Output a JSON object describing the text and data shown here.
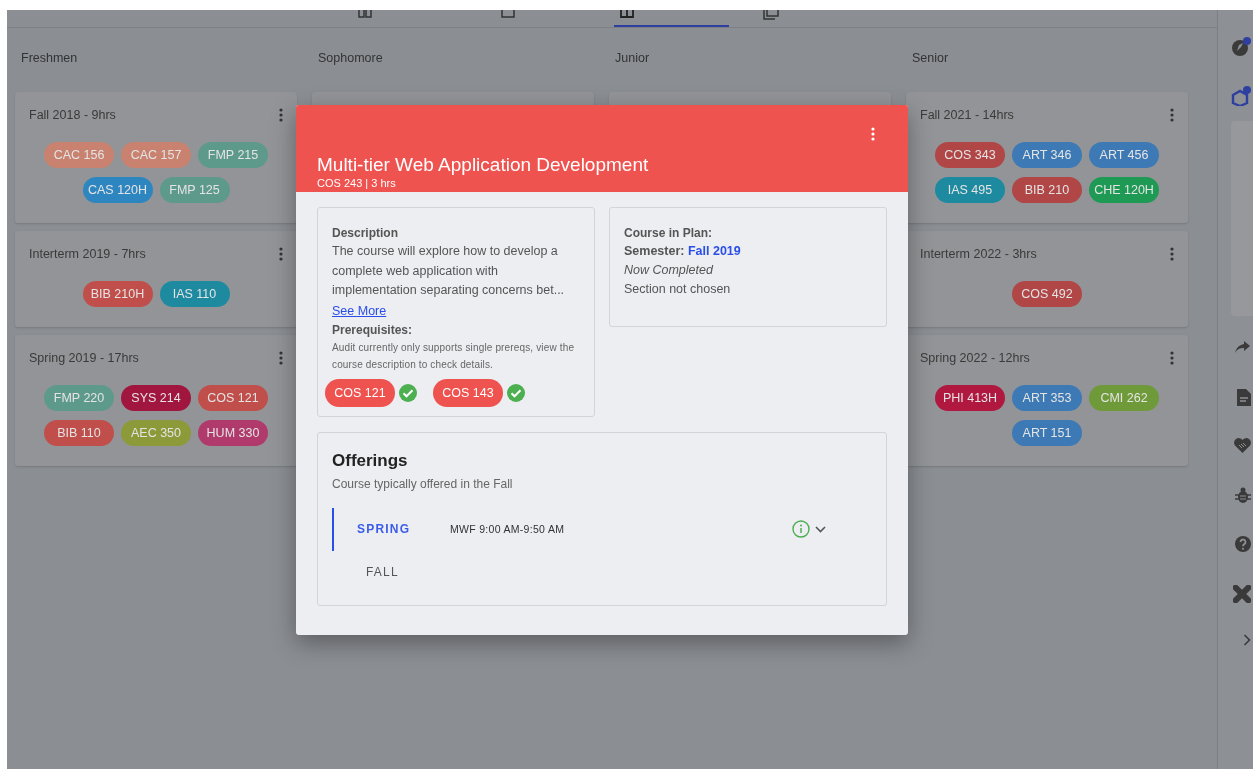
{
  "tabs": [
    {
      "kind": "grid",
      "selected": false
    },
    {
      "kind": "square",
      "selected": false
    },
    {
      "kind": "calendar",
      "selected": true
    },
    {
      "kind": "stack",
      "selected": false
    }
  ],
  "columns": [
    {
      "title": "Freshmen",
      "semesters": [
        {
          "title": "Fall 2018 - 9hrs",
          "courses": [
            {
              "code": "CAC 156",
              "color": "#c8826f"
            },
            {
              "code": "CAC 157",
              "color": "#c8826f"
            },
            {
              "code": "FMP 215",
              "color": "#5e9a8b"
            },
            {
              "code": "CAS 120H",
              "color": "#2e86c1"
            },
            {
              "code": "FMP 125",
              "color": "#5e9a8b"
            }
          ]
        },
        {
          "title": "Interterm 2019 - 7hrs",
          "courses": [
            {
              "code": "BIB 210H",
              "color": "#c04e4a"
            },
            {
              "code": "IAS 110",
              "color": "#1d8aa0"
            }
          ]
        },
        {
          "title": "Spring 2019 - 17hrs",
          "courses": [
            {
              "code": "FMP 220",
              "color": "#5e9a8b"
            },
            {
              "code": "SYS 214",
              "color": "#a0163f"
            },
            {
              "code": "COS 121",
              "color": "#c04e4a"
            },
            {
              "code": "BIB 110",
              "color": "#c04e4a"
            },
            {
              "code": "AEC 350",
              "color": "#8c9a3a"
            },
            {
              "code": "HUM 330",
              "color": "#b03a6b"
            }
          ]
        }
      ]
    },
    {
      "title": "Sophomore"
    },
    {
      "title": "Junior"
    },
    {
      "title": "Senior",
      "semesters": [
        {
          "title": "Fall 2021 - 14hrs",
          "courses": [
            {
              "code": "COS 343",
              "color": "#b04646"
            },
            {
              "code": "ART 346",
              "color": "#3d7ab5"
            },
            {
              "code": "ART 456",
              "color": "#3d7ab5"
            },
            {
              "code": "IAS 495",
              "color": "#1d8aa0"
            },
            {
              "code": "BIB 210",
              "color": "#b04646"
            },
            {
              "code": "CHE 120H",
              "color": "#1e9a55"
            }
          ]
        },
        {
          "title": "Interterm 2022 - 3hrs",
          "courses": [
            {
              "code": "COS 492",
              "color": "#b04646"
            }
          ]
        },
        {
          "title": "Spring 2022 - 12hrs",
          "courses": [
            {
              "code": "PHI 413H",
              "color": "#b01840"
            },
            {
              "code": "ART 353",
              "color": "#3d7ab5"
            },
            {
              "code": "CMI 262",
              "color": "#6f9a3a"
            },
            {
              "code": "ART 151",
              "color": "#3d7ab5"
            }
          ]
        }
      ]
    }
  ],
  "modal": {
    "title": "Multi-tier Web Application Development",
    "subtitle": "COS 243 | 3 hrs",
    "description": {
      "heading": "Description",
      "text": "The course will explore how to develop a complete web application with implementation separating concerns bet...",
      "link": "See More",
      "prereq_heading": "Prerequisites:",
      "prereq_note": "Audit currently only supports single prereqs, view the course description to check details.",
      "prereqs": [
        {
          "code": "COS 121",
          "met": true
        },
        {
          "code": "COS 143",
          "met": true
        }
      ]
    },
    "plan": {
      "heading": "Course in Plan:",
      "semester_label": "Semester:",
      "semester": "Fall 2019",
      "status": "Now Completed",
      "section": "Section not chosen"
    },
    "offerings": {
      "heading": "Offerings",
      "note": "Course typically offered in the Fall",
      "terms": [
        {
          "term": "SPRING",
          "selected": true,
          "time": "MWF 9:00 AM-9:50 AM"
        },
        {
          "term": "FALL",
          "selected": false
        }
      ]
    }
  },
  "sidebar": [
    {
      "kind": "pen",
      "badge": true
    },
    {
      "kind": "box",
      "badge": true
    },
    {
      "kind": "panel"
    },
    {
      "kind": "share"
    },
    {
      "kind": "document"
    },
    {
      "kind": "handshake"
    },
    {
      "kind": "bug"
    },
    {
      "kind": "help"
    },
    {
      "kind": "bandage"
    },
    {
      "kind": "chevron"
    }
  ]
}
